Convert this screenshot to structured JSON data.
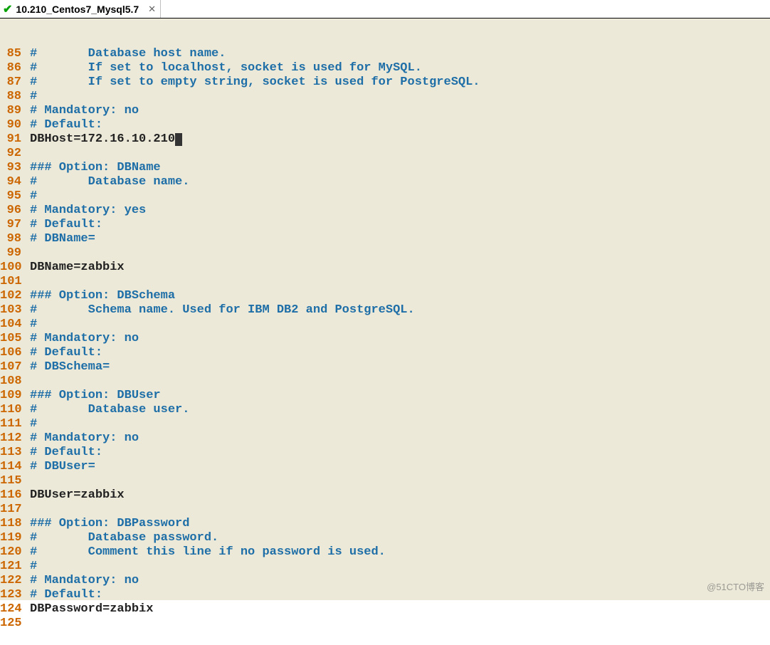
{
  "tab": {
    "title": "10.210_Centos7_Mysql5.7",
    "check_icon": "✔",
    "close_icon": "✕"
  },
  "watermark": "@51CTO博客",
  "cursor_line": 91,
  "lines": [
    {
      "n": 85,
      "type": "comment",
      "text": "#       Database host name."
    },
    {
      "n": 86,
      "type": "comment",
      "text": "#       If set to localhost, socket is used for MySQL."
    },
    {
      "n": 87,
      "type": "comment",
      "text": "#       If set to empty string, socket is used for PostgreSQL."
    },
    {
      "n": 88,
      "type": "comment",
      "text": "#"
    },
    {
      "n": 89,
      "type": "comment",
      "text": "# Mandatory: no"
    },
    {
      "n": 90,
      "type": "comment",
      "text": "# Default:"
    },
    {
      "n": 91,
      "type": "plain",
      "text": "DBHost=172.16.10.210"
    },
    {
      "n": 92,
      "type": "plain",
      "text": ""
    },
    {
      "n": 93,
      "type": "comment",
      "text": "### Option: DBName"
    },
    {
      "n": 94,
      "type": "comment",
      "text": "#       Database name."
    },
    {
      "n": 95,
      "type": "comment",
      "text": "#"
    },
    {
      "n": 96,
      "type": "comment",
      "text": "# Mandatory: yes"
    },
    {
      "n": 97,
      "type": "comment",
      "text": "# Default:"
    },
    {
      "n": 98,
      "type": "comment",
      "text": "# DBName="
    },
    {
      "n": 99,
      "type": "plain",
      "text": ""
    },
    {
      "n": 100,
      "type": "plain",
      "text": "DBName=zabbix"
    },
    {
      "n": 101,
      "type": "plain",
      "text": ""
    },
    {
      "n": 102,
      "type": "comment",
      "text": "### Option: DBSchema"
    },
    {
      "n": 103,
      "type": "comment",
      "text": "#       Schema name. Used for IBM DB2 and PostgreSQL."
    },
    {
      "n": 104,
      "type": "comment",
      "text": "#"
    },
    {
      "n": 105,
      "type": "comment",
      "text": "# Mandatory: no"
    },
    {
      "n": 106,
      "type": "comment",
      "text": "# Default:"
    },
    {
      "n": 107,
      "type": "comment",
      "text": "# DBSchema="
    },
    {
      "n": 108,
      "type": "plain",
      "text": ""
    },
    {
      "n": 109,
      "type": "comment",
      "text": "### Option: DBUser"
    },
    {
      "n": 110,
      "type": "comment",
      "text": "#       Database user."
    },
    {
      "n": 111,
      "type": "comment",
      "text": "#"
    },
    {
      "n": 112,
      "type": "comment",
      "text": "# Mandatory: no"
    },
    {
      "n": 113,
      "type": "comment",
      "text": "# Default:"
    },
    {
      "n": 114,
      "type": "comment",
      "text": "# DBUser="
    },
    {
      "n": 115,
      "type": "plain",
      "text": ""
    },
    {
      "n": 116,
      "type": "plain",
      "text": "DBUser=zabbix"
    },
    {
      "n": 117,
      "type": "plain",
      "text": ""
    },
    {
      "n": 118,
      "type": "comment",
      "text": "### Option: DBPassword"
    },
    {
      "n": 119,
      "type": "comment",
      "text": "#       Database password."
    },
    {
      "n": 120,
      "type": "comment",
      "text": "#       Comment this line if no password is used."
    },
    {
      "n": 121,
      "type": "comment",
      "text": "#"
    },
    {
      "n": 122,
      "type": "comment",
      "text": "# Mandatory: no"
    },
    {
      "n": 123,
      "type": "comment",
      "text": "# Default:"
    },
    {
      "n": 124,
      "type": "plain",
      "text": "DBPassword=zabbix"
    },
    {
      "n": 125,
      "type": "plain",
      "text": ""
    }
  ]
}
